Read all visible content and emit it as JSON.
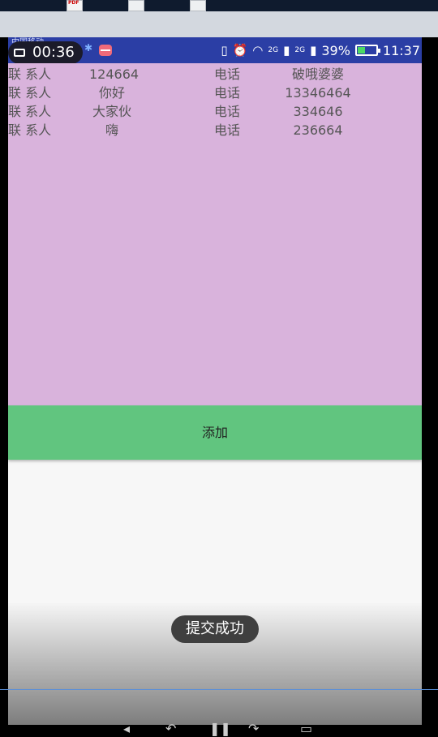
{
  "status_bar": {
    "carrier": "中国移动",
    "recording_time": "00:36",
    "network_2g_a": "2G",
    "network_2g_b": "2G",
    "battery_percent": "39%",
    "battery_level": 0.39,
    "clock": "11:37"
  },
  "contacts": [
    {
      "label": "联 系人",
      "name": "124664",
      "tel_label": "电话",
      "phone": "破哦婆婆"
    },
    {
      "label": "联 系人",
      "name": "你好",
      "tel_label": "电话",
      "phone": "13346464"
    },
    {
      "label": "联 系人",
      "name": "大家伙",
      "tel_label": "电话",
      "phone": "334646"
    },
    {
      "label": "联 系人",
      "name": "嗨",
      "tel_label": "电话",
      "phone": "236664"
    }
  ],
  "add_button": {
    "label": "添加"
  },
  "toast": {
    "message": "提交成功"
  },
  "colors": {
    "list_bg": "#d9b3dc",
    "add_button_bg": "#61c57f",
    "status_bar_bg": "#2b3ea5"
  }
}
